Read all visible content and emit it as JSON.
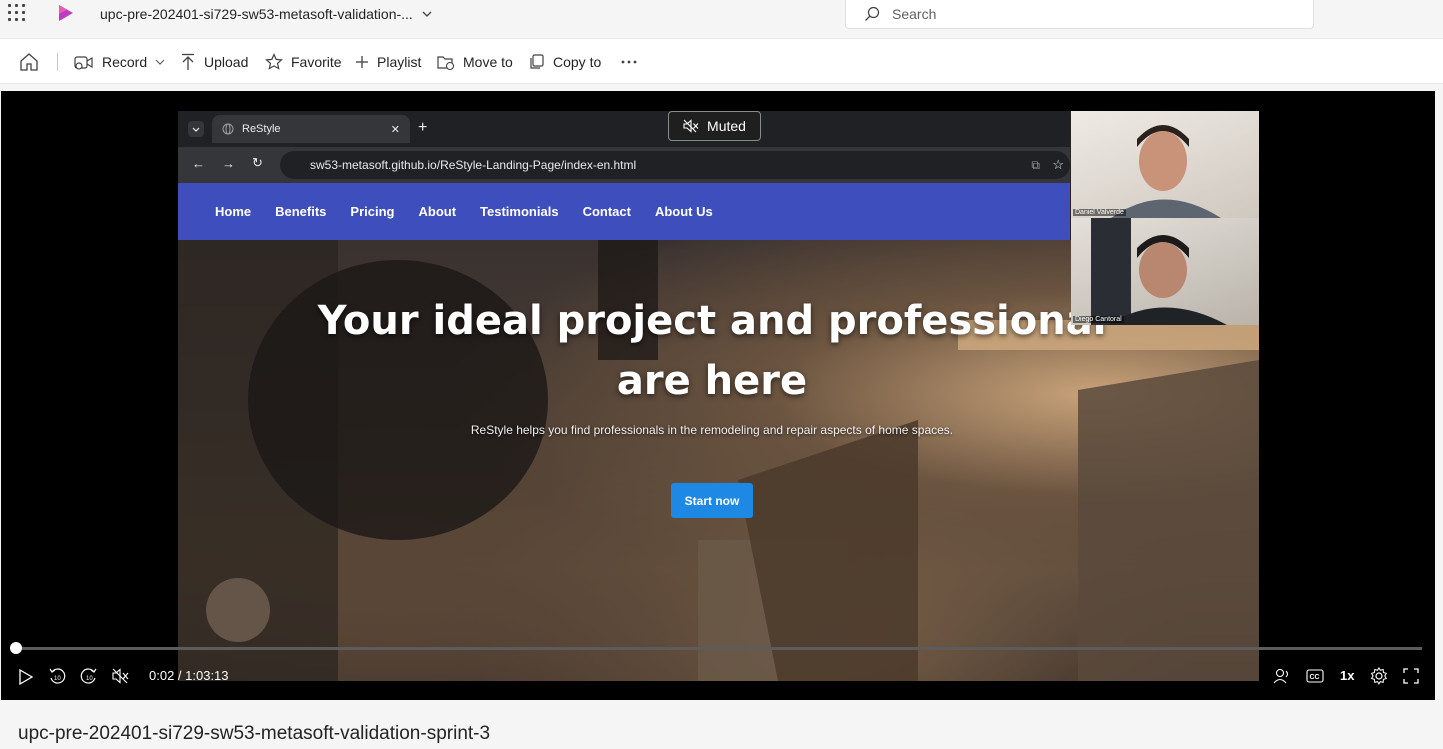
{
  "topbar": {
    "title": "upc-pre-202401-si729-sw53-metasoft-validation-...",
    "search_placeholder": "Search"
  },
  "toolbar": {
    "record": "Record",
    "upload": "Upload",
    "favorite": "Favorite",
    "playlist": "Playlist",
    "move_to": "Move to",
    "copy_to": "Copy to"
  },
  "video": {
    "browser_tab_title": "ReStyle",
    "url": "sw53-metasoft.github.io/ReStyle-Landing-Page/index-en.html",
    "nav": [
      "Home",
      "Benefits",
      "Pricing",
      "About",
      "Testimonials",
      "Contact",
      "About Us"
    ],
    "hero_title_line1": "Your ideal project and professional",
    "hero_title_line2": "are here",
    "hero_subtitle": "ReStyle helps you find professionals in the remodeling and repair aspects of home spaces.",
    "hero_button": "Start now",
    "participant_1": "Daniel Valverde",
    "participant_2": "Diego Cantoral"
  },
  "player": {
    "muted_label": "Muted",
    "time": "0:02 / 1:03:13",
    "speed": "1x",
    "progress_fraction": 0.0005
  },
  "page_title": "upc-pre-202401-si729-sw53-metasoft-validation-sprint-3"
}
